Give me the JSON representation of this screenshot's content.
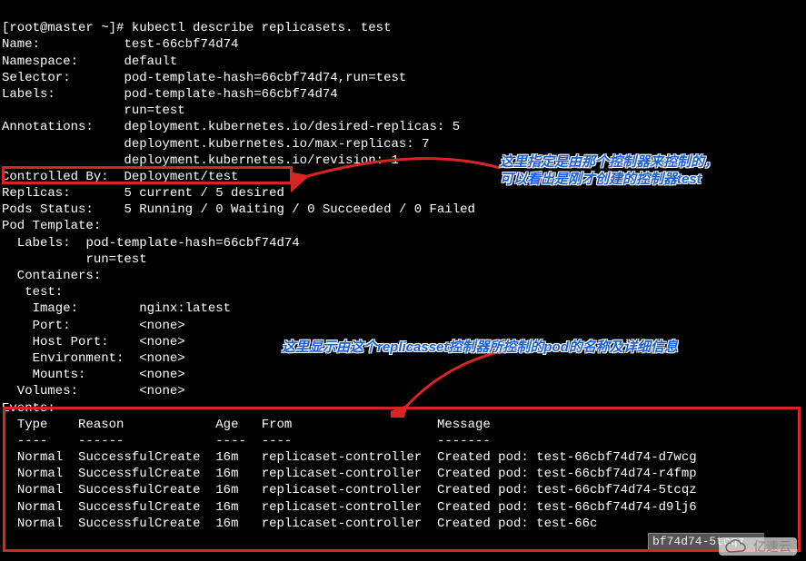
{
  "prompt": "[root@master ~]# ",
  "command": "kubectl describe replicasets. test",
  "fields": {
    "name_k": "Name:",
    "name_v": "test-66cbf74d74",
    "ns_k": "Namespace:",
    "ns_v": "default",
    "sel_k": "Selector:",
    "sel_v": "pod-template-hash=66cbf74d74,run=test",
    "lab_k": "Labels:",
    "lab_v1": "pod-template-hash=66cbf74d74",
    "lab_v2": "run=test",
    "ann_k": "Annotations:",
    "ann_v1": "deployment.kubernetes.io/desired-replicas: 5",
    "ann_v2": "deployment.kubernetes.io/max-replicas: 7",
    "ann_v3": "deployment.kubernetes.io/revision: 1",
    "ctrl_k": "Controlled By:",
    "ctrl_v": "Deployment/test",
    "rep_k": "Replicas:",
    "rep_v": "5 current / 5 desired",
    "pods_k": "Pods Status:",
    "pods_v": "5 Running / 0 Waiting / 0 Succeeded / 0 Failed",
    "pt_k": "Pod Template:",
    "pt_lab_k": "  Labels:",
    "pt_lab_v1": "pod-template-hash=66cbf74d74",
    "pt_lab_v2": "run=test",
    "cont_k": "  Containers:",
    "cont_name": "   test:",
    "img_k": "    Image:",
    "img_v": "nginx:latest",
    "port_k": "    Port:",
    "port_v": "<none>",
    "hport_k": "    Host Port:",
    "hport_v": "<none>",
    "env_k": "    Environment:",
    "env_v": "<none>",
    "mnt_k": "    Mounts:",
    "mnt_v": "<none>",
    "vol_k": "  Volumes:",
    "vol_v": "<none>"
  },
  "events": {
    "header": "Events:",
    "cols": {
      "type": "Type",
      "reason": "Reason",
      "age": "Age",
      "from": "From",
      "message": "Message"
    },
    "dashes": {
      "type": "----",
      "reason": "------",
      "age": "----",
      "from": "----",
      "message": "-------"
    },
    "rows": [
      {
        "type": "Normal",
        "reason": "SuccessfulCreate",
        "age": "16m",
        "from": "replicaset-controller",
        "message": "Created pod: test-66cbf74d74-d7wcg"
      },
      {
        "type": "Normal",
        "reason": "SuccessfulCreate",
        "age": "16m",
        "from": "replicaset-controller",
        "message": "Created pod: test-66cbf74d74-r4fmp"
      },
      {
        "type": "Normal",
        "reason": "SuccessfulCreate",
        "age": "16m",
        "from": "replicaset-controller",
        "message": "Created pod: test-66cbf74d74-5tcqz"
      },
      {
        "type": "Normal",
        "reason": "SuccessfulCreate",
        "age": "16m",
        "from": "replicaset-controller",
        "message": "Created pod: test-66cbf74d74-d9lj6"
      },
      {
        "type": "Normal",
        "reason": "SuccessfulCreate",
        "age": "16m",
        "from": "replicaset-controller",
        "message": "Created pod: test-66c"
      }
    ]
  },
  "truncated_overlay": "bf74d74-5tcqz",
  "annotations": {
    "a1_l1": "这里指定是由那个控制器来控制的，",
    "a1_l2": "可以看出是刚才创建的控制器test",
    "a2": "这里显示由这个replicasset控制器所控制的pod的名称及详细信息"
  },
  "watermark": "亿速云"
}
